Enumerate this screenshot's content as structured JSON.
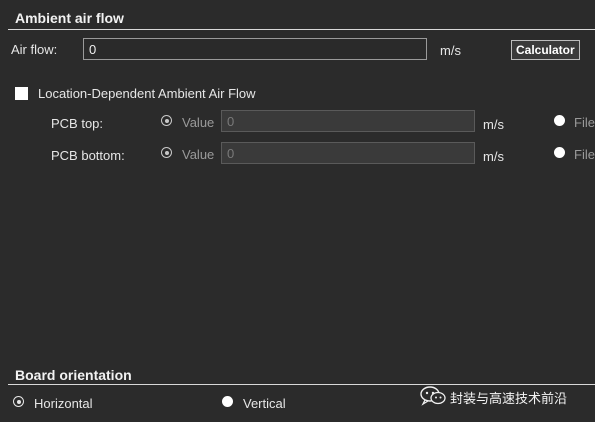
{
  "ambient": {
    "title": "Ambient air flow",
    "air_flow_label": "Air flow:",
    "air_flow_value": "0",
    "air_flow_unit": "m/s",
    "calculator_label": "Calculator",
    "location_dependent_label": "Location-Dependent Ambient Air Flow",
    "location_dependent_checked": false,
    "pcb_top": {
      "label": "PCB top:",
      "value_option": "Value",
      "value": "0",
      "unit": "m/s",
      "file_option": "File",
      "selected": "Value"
    },
    "pcb_bottom": {
      "label": "PCB bottom:",
      "value_option": "Value",
      "value": "0",
      "unit": "m/s",
      "file_option": "File",
      "selected": "Value"
    }
  },
  "board": {
    "title": "Board orientation",
    "horizontal_label": "Horizontal",
    "vertical_label": "Vertical",
    "selected": "Horizontal"
  },
  "watermark": {
    "text": "封装与高速技术前沿",
    "icon": "wechat-icon"
  }
}
